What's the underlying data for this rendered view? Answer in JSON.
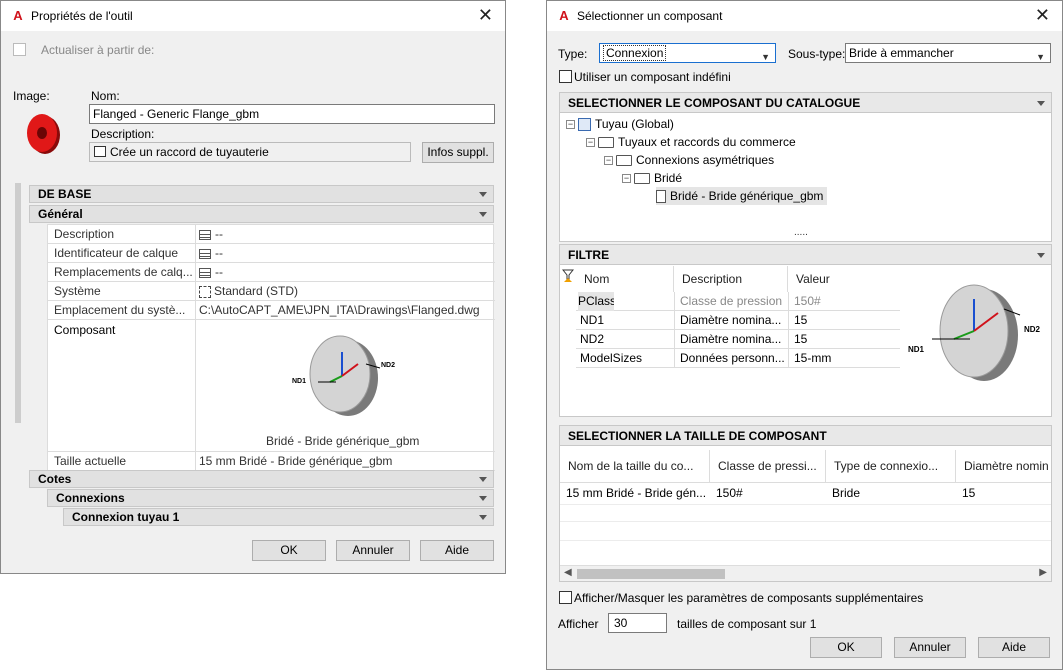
{
  "left": {
    "title": "Propriétés de l'outil",
    "update_label": "Actualiser à partir de:",
    "image_label": "Image:",
    "name_label": "Nom:",
    "name_value": "Flanged - Generic Flange_gbm",
    "desc_label": "Description:",
    "desc_value": "Crée un raccord de tuyauterie",
    "infos_btn": "Infos suppl.",
    "sec_base": "DE BASE",
    "sec_general": "Général",
    "props": [
      {
        "label": "Description",
        "value": "--"
      },
      {
        "label": "Identificateur de calque",
        "value": "--"
      },
      {
        "label": "Remplacements de calq...",
        "value": "--"
      },
      {
        "label": "Système",
        "value": "Standard (STD)"
      },
      {
        "label": "Emplacement du systè...",
        "value": "C:\\AutoCAPT_AME\\JPN_ITA\\Drawings\\Flanged.dwg"
      }
    ],
    "component_label": "Composant",
    "component_caption": "Bridé - Bride générique_gbm",
    "nd1": "ND1",
    "nd2": "ND2",
    "size_label": "Taille actuelle",
    "size_value": "15 mm Bridé - Bride générique_gbm",
    "sec_cotes": "Cotes",
    "sec_connexions": "Connexions",
    "sec_connexion_tuyau": "Connexion tuyau 1",
    "ok": "OK",
    "cancel": "Annuler",
    "help": "Aide"
  },
  "right": {
    "title": "Sélectionner un composant",
    "type_label": "Type:",
    "type_value": "Connexion",
    "subtype_label": "Sous-type:",
    "subtype_value": "Bride à emmancher",
    "undefined_label": "Utiliser un composant indéfini",
    "catalog_header": "SELECTIONNER LE COMPOSANT DU CATALOGUE",
    "tree": [
      "Tuyau (Global)",
      "Tuyaux et raccords du commerce",
      "Connexions asymétriques",
      "Bridé",
      "Bridé - Bride générique_gbm"
    ],
    "splitter": ".....",
    "filter_header": "FILTRE",
    "filter_cols": [
      "Nom",
      "Description",
      "Valeur"
    ],
    "filter_rows": [
      [
        "PClass",
        "Classe de pression",
        "150#"
      ],
      [
        "ND1",
        "Diamètre nomina...",
        "15"
      ],
      [
        "ND2",
        "Diamètre nomina...",
        "15"
      ],
      [
        "ModelSizes",
        "Données personn...",
        "15-mm"
      ]
    ],
    "nd1": "ND1",
    "nd2": "ND2",
    "size_header": "SELECTIONNER LA TAILLE DE COMPOSANT",
    "size_cols": [
      "Nom de la taille du co...",
      "Classe de pressi...",
      "Type de connexio...",
      "Diamètre nomin"
    ],
    "size_row": [
      "15 mm Bridé - Bride gén...",
      "150#",
      "Bride",
      "15"
    ],
    "show_params": "Afficher/Masquer les paramètres de composants supplémentaires",
    "afficher_label": "Afficher",
    "afficher_value": "30",
    "sizes_suffix": "tailles de composant sur 1",
    "ok": "OK",
    "cancel": "Annuler",
    "help": "Aide"
  },
  "colors": {
    "accent": "#d0121b",
    "axis_x": "#d0121b",
    "axis_y": "#1a9c1a",
    "axis_z": "#1a4fd0"
  }
}
